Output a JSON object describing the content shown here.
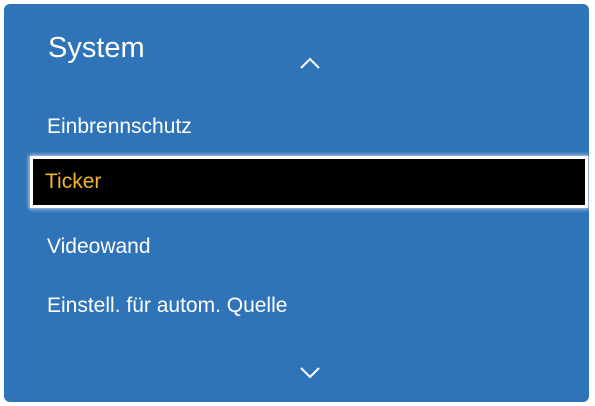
{
  "menu": {
    "title": "System",
    "items": [
      {
        "label": "Einbrennschutz",
        "selected": false
      },
      {
        "label": "Ticker",
        "selected": true
      },
      {
        "label": "Videowand",
        "selected": false
      },
      {
        "label": "Einstell. für autom. Quelle",
        "selected": false
      }
    ],
    "scroll_up_icon": "chevron-up-icon",
    "scroll_down_icon": "chevron-down-icon"
  },
  "colors": {
    "panel_background": "#2f73b8",
    "text": "#ffffff",
    "selected_background": "#000000",
    "selected_text": "#f0b428",
    "selected_border": "#ffffff"
  }
}
